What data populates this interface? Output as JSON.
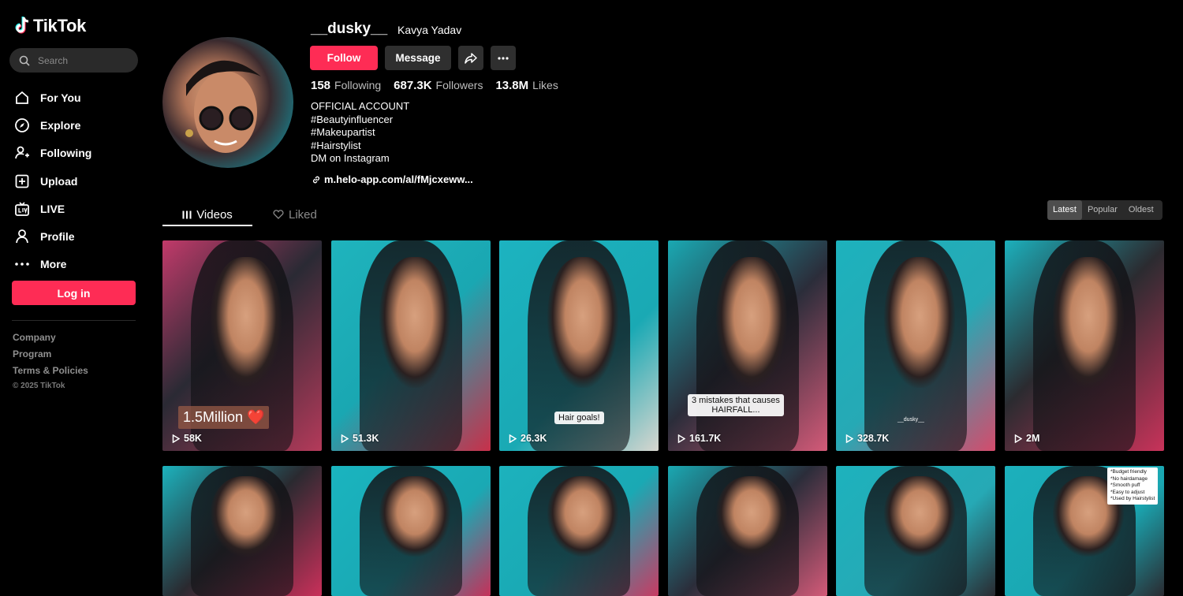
{
  "brand": {
    "name": "TikTok",
    "accent": "#fe2c55"
  },
  "search": {
    "placeholder": "Search"
  },
  "nav": [
    {
      "label": "For You",
      "icon": "home-icon"
    },
    {
      "label": "Explore",
      "icon": "compass-icon"
    },
    {
      "label": "Following",
      "icon": "following-icon"
    },
    {
      "label": "Upload",
      "icon": "upload-icon"
    },
    {
      "label": "LIVE",
      "icon": "live-icon"
    },
    {
      "label": "Profile",
      "icon": "profile-icon"
    },
    {
      "label": "More",
      "icon": "more-icon"
    }
  ],
  "login_label": "Log in",
  "footer": {
    "links": [
      "Company",
      "Program",
      "Terms & Policies"
    ],
    "copyright": "© 2025 TikTok"
  },
  "profile": {
    "username": "__dusky__",
    "nickname": "Kavya Yadav",
    "follow_label": "Follow",
    "message_label": "Message",
    "stats": {
      "following": "158",
      "following_label": "Following",
      "followers": "687.3K",
      "followers_label": "Followers",
      "likes": "13.8M",
      "likes_label": "Likes"
    },
    "bio": [
      "OFFICIAL ACCOUNT",
      "#Beautyinfluencer",
      "#Makeupartist",
      "#Hairstylist",
      "DM on Instagram"
    ],
    "link": "m.helo-app.com/al/fMjcxeww..."
  },
  "tabs": {
    "videos": "Videos",
    "liked": "Liked"
  },
  "sort": {
    "options": [
      "Latest",
      "Popular",
      "Oldest"
    ],
    "active": "Latest"
  },
  "videos": [
    {
      "views": "58K",
      "overlay": "1.5Million ❤️"
    },
    {
      "views": "51.3K"
    },
    {
      "views": "26.3K",
      "caption": "Hair goals!"
    },
    {
      "views": "161.7K",
      "caption": "3 mistakes that causes\nHAIRFALL..."
    },
    {
      "views": "328.7K",
      "caption": "__dusky__"
    },
    {
      "views": "2M"
    },
    {},
    {},
    {},
    {},
    {},
    {
      "note": "*Budget friendly\n*No hairdamage\n*Smooth puff\n*Easy to adjust\n*Used by Hairstylist"
    }
  ]
}
